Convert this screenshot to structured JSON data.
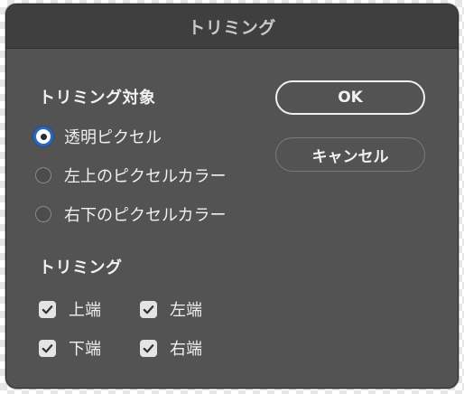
{
  "dialog": {
    "title": "トリミング"
  },
  "trim_target": {
    "heading": "トリミング対象",
    "options": [
      {
        "label": "透明ピクセル",
        "selected": true
      },
      {
        "label": "左上のピクセルカラー",
        "selected": false
      },
      {
        "label": "右下のピクセルカラー",
        "selected": false
      }
    ]
  },
  "trim": {
    "heading": "トリミング",
    "checkboxes": [
      {
        "label": "上端",
        "checked": true
      },
      {
        "label": "左端",
        "checked": true
      },
      {
        "label": "下端",
        "checked": true
      },
      {
        "label": "右端",
        "checked": true
      }
    ]
  },
  "buttons": {
    "ok_label": "OK",
    "cancel_label": "キャンセル"
  },
  "colors": {
    "dialog_bg": "#535353",
    "titlebar_bg": "#3f3f3f",
    "radio_accent": "#2e66b8",
    "checkbox_bg": "#e4e4e4"
  },
  "icons": {
    "checkmark": "checkmark-icon",
    "radio": "radio-icon"
  }
}
